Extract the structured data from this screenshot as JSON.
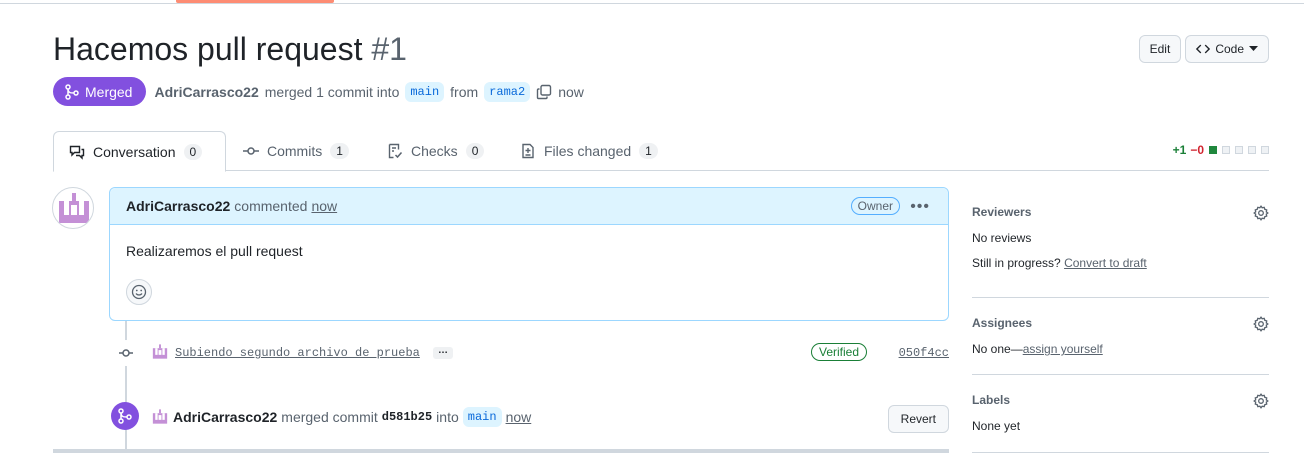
{
  "pr": {
    "title": "Hacemos pull request",
    "number": "#1",
    "state": "Merged",
    "author": "AdriCarrasco22",
    "summary": "merged 1 commit into",
    "base_branch": "main",
    "from_word": "from",
    "head_branch": "rama2",
    "time": "now"
  },
  "header_actions": {
    "edit": "Edit",
    "code": "Code"
  },
  "tabs": [
    {
      "label": "Conversation",
      "count": "0"
    },
    {
      "label": "Commits",
      "count": "1"
    },
    {
      "label": "Checks",
      "count": "0"
    },
    {
      "label": "Files changed",
      "count": "1"
    }
  ],
  "diffstat": {
    "additions": "+1",
    "deletions": "−0"
  },
  "comment": {
    "author": "AdriCarrasco22",
    "action": "commented",
    "time": "now",
    "role": "Owner",
    "body": "Realizaremos el pull request"
  },
  "commit": {
    "message": "Subiendo segundo archivo de prueba",
    "more": "…",
    "status": "Verified",
    "sha": "050f4cc"
  },
  "merge_event": {
    "author": "AdriCarrasco22",
    "action": "merged commit",
    "sha": "d581b25",
    "into": "into",
    "branch": "main",
    "time": "now",
    "revert": "Revert"
  },
  "sidebar": {
    "reviewers": {
      "title": "Reviewers",
      "value": "No reviews",
      "status_prefix": "Still in progress?",
      "status_link": "Convert to draft"
    },
    "assignees": {
      "title": "Assignees",
      "value": "No one—",
      "link": "assign yourself"
    },
    "labels": {
      "title": "Labels",
      "value": "None yet"
    }
  },
  "colors": {
    "merged": "#8250df",
    "accent": "#fd8c73",
    "branch_bg": "#ddf4ff",
    "additions": "#1a7f37",
    "deletions": "#d1242f"
  }
}
